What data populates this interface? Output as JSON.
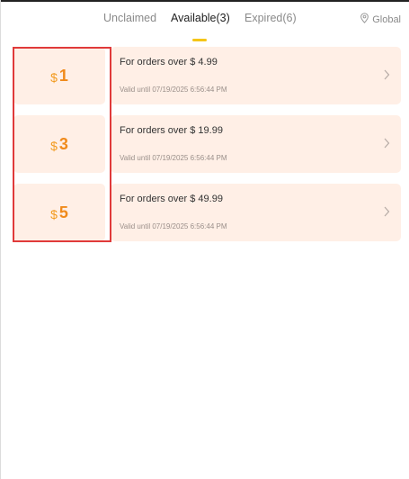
{
  "tabs": [
    {
      "label": "Unclaimed",
      "active": false
    },
    {
      "label": "Available(3)",
      "active": true
    },
    {
      "label": "Expired(6)",
      "active": false
    }
  ],
  "region": {
    "label": "Global",
    "icon": "location-pin-icon"
  },
  "coupons": [
    {
      "currency": "$",
      "amount": "1",
      "condition": "For orders over $ 4.99",
      "validity": "Valid until 07/19/2025 6:56:44 PM"
    },
    {
      "currency": "$",
      "amount": "3",
      "condition": "For orders over $ 19.99",
      "validity": "Valid until 07/19/2025 6:56:44 PM"
    },
    {
      "currency": "$",
      "amount": "5",
      "condition": "For orders over $ 49.99",
      "validity": "Valid until 07/19/2025 6:56:44 PM"
    }
  ],
  "colors": {
    "accent": "#f5c518",
    "coupon_bg": "#ffefe6",
    "amount": "#f08a1b",
    "highlight": "#e03a3a"
  }
}
